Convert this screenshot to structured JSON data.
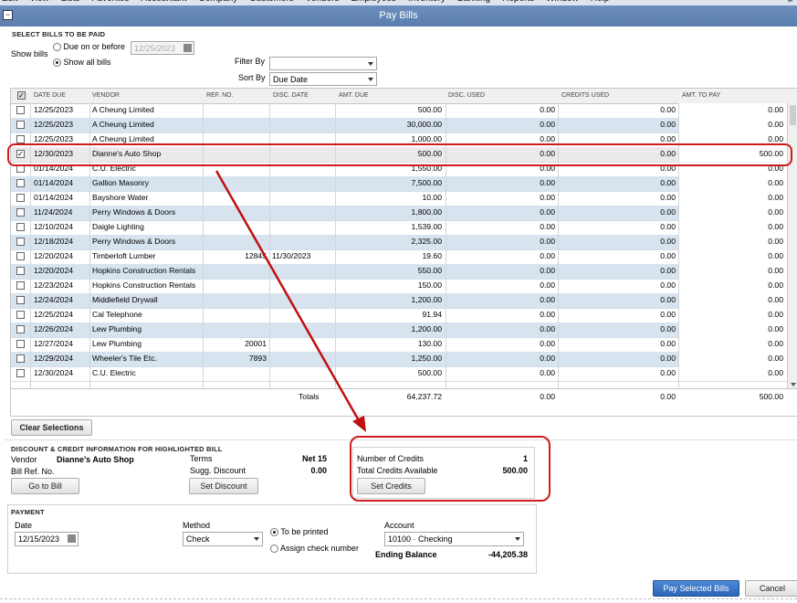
{
  "menubar": [
    "Edit",
    "View",
    "Lists",
    "Favorites",
    "Accountant",
    "Company",
    "Customers",
    "Vendors",
    "Employees",
    "Inventory",
    "Banking",
    "Reports",
    "Window",
    "Help"
  ],
  "window": {
    "title": "Pay Bills"
  },
  "select_section": {
    "label": "SELECT BILLS TO BE PAID",
    "show_bills_label": "Show bills",
    "due_on_before_label": "Due on or before",
    "due_date_value": "12/25/2023",
    "show_all_label": "Show all bills",
    "filter_by_label": "Filter By",
    "filter_by_value": "",
    "sort_by_label": "Sort By",
    "sort_by_value": "Due Date"
  },
  "table": {
    "columns": [
      "DATE DUE",
      "VENDOR",
      "REF. NO.",
      "DISC. DATE",
      "AMT. DUE",
      "DISC. USED",
      "CREDITS USED",
      "AMT. TO PAY"
    ],
    "rows": [
      {
        "checked": false,
        "date": "12/25/2023",
        "vendor": "A Cheung Limited",
        "ref": "",
        "disc_date": "",
        "amt_due": "500.00",
        "disc_used": "0.00",
        "credits_used": "0.00",
        "amt_to_pay": "0.00"
      },
      {
        "checked": false,
        "date": "12/25/2023",
        "vendor": "A Cheung Limited",
        "ref": "",
        "disc_date": "",
        "amt_due": "30,000.00",
        "disc_used": "0.00",
        "credits_used": "0.00",
        "amt_to_pay": "0.00"
      },
      {
        "checked": false,
        "date": "12/25/2023",
        "vendor": "A Cheung Limited",
        "ref": "",
        "disc_date": "",
        "amt_due": "1,000.00",
        "disc_used": "0.00",
        "credits_used": "0.00",
        "amt_to_pay": "0.00"
      },
      {
        "checked": true,
        "date": "12/30/2023",
        "vendor": "Dianne's Auto Shop",
        "ref": "",
        "disc_date": "",
        "amt_due": "500.00",
        "disc_used": "0.00",
        "credits_used": "0.00",
        "amt_to_pay": "500.00"
      },
      {
        "checked": false,
        "date": "01/14/2024",
        "vendor": "C.U. Electric",
        "ref": "",
        "disc_date": "",
        "amt_due": "1,550.00",
        "disc_used": "0.00",
        "credits_used": "0.00",
        "amt_to_pay": "0.00"
      },
      {
        "checked": false,
        "date": "01/14/2024",
        "vendor": "Gallion Masonry",
        "ref": "",
        "disc_date": "",
        "amt_due": "7,500.00",
        "disc_used": "0.00",
        "credits_used": "0.00",
        "amt_to_pay": "0.00"
      },
      {
        "checked": false,
        "date": "01/14/2024",
        "vendor": "Bayshore Water",
        "ref": "",
        "disc_date": "",
        "amt_due": "10.00",
        "disc_used": "0.00",
        "credits_used": "0.00",
        "amt_to_pay": "0.00"
      },
      {
        "checked": false,
        "date": "11/24/2024",
        "vendor": "Perry Windows & Doors",
        "ref": "",
        "disc_date": "",
        "amt_due": "1,800.00",
        "disc_used": "0.00",
        "credits_used": "0.00",
        "amt_to_pay": "0.00"
      },
      {
        "checked": false,
        "date": "12/10/2024",
        "vendor": "Daigle Lighting",
        "ref": "",
        "disc_date": "",
        "amt_due": "1,539.00",
        "disc_used": "0.00",
        "credits_used": "0.00",
        "amt_to_pay": "0.00"
      },
      {
        "checked": false,
        "date": "12/18/2024",
        "vendor": "Perry Windows & Doors",
        "ref": "",
        "disc_date": "",
        "amt_due": "2,325.00",
        "disc_used": "0.00",
        "credits_used": "0.00",
        "amt_to_pay": "0.00"
      },
      {
        "checked": false,
        "date": "12/20/2024",
        "vendor": "Timberloft Lumber",
        "ref": "12845",
        "disc_date": "11/30/2023",
        "amt_due": "19.60",
        "disc_used": "0.00",
        "credits_used": "0.00",
        "amt_to_pay": "0.00"
      },
      {
        "checked": false,
        "date": "12/20/2024",
        "vendor": "Hopkins Construction Rentals",
        "ref": "",
        "disc_date": "",
        "amt_due": "550.00",
        "disc_used": "0.00",
        "credits_used": "0.00",
        "amt_to_pay": "0.00"
      },
      {
        "checked": false,
        "date": "12/23/2024",
        "vendor": "Hopkins Construction Rentals",
        "ref": "",
        "disc_date": "",
        "amt_due": "150.00",
        "disc_used": "0.00",
        "credits_used": "0.00",
        "amt_to_pay": "0.00"
      },
      {
        "checked": false,
        "date": "12/24/2024",
        "vendor": "Middlefield Drywall",
        "ref": "",
        "disc_date": "",
        "amt_due": "1,200.00",
        "disc_used": "0.00",
        "credits_used": "0.00",
        "amt_to_pay": "0.00"
      },
      {
        "checked": false,
        "date": "12/25/2024",
        "vendor": "Cal Telephone",
        "ref": "",
        "disc_date": "",
        "amt_due": "91.94",
        "disc_used": "0.00",
        "credits_used": "0.00",
        "amt_to_pay": "0.00"
      },
      {
        "checked": false,
        "date": "12/26/2024",
        "vendor": "Lew Plumbing",
        "ref": "",
        "disc_date": "",
        "amt_due": "1,200.00",
        "disc_used": "0.00",
        "credits_used": "0.00",
        "amt_to_pay": "0.00"
      },
      {
        "checked": false,
        "date": "12/27/2024",
        "vendor": "Lew Plumbing",
        "ref": "20001",
        "disc_date": "",
        "amt_due": "130.00",
        "disc_used": "0.00",
        "credits_used": "0.00",
        "amt_to_pay": "0.00"
      },
      {
        "checked": false,
        "date": "12/29/2024",
        "vendor": "Wheeler's Tile Etc.",
        "ref": "7893",
        "disc_date": "",
        "amt_due": "1,250.00",
        "disc_used": "0.00",
        "credits_used": "0.00",
        "amt_to_pay": "0.00"
      },
      {
        "checked": false,
        "date": "12/30/2024",
        "vendor": "C.U. Electric",
        "ref": "",
        "disc_date": "",
        "amt_due": "500.00",
        "disc_used": "0.00",
        "credits_used": "0.00",
        "amt_to_pay": "0.00"
      }
    ],
    "totals": {
      "label": "Totals",
      "amt_due": "64,237.72",
      "disc_used": "0.00",
      "credits_used": "0.00",
      "amt_to_pay": "500.00"
    }
  },
  "clear_selections_label": "Clear Selections",
  "discount_section": {
    "label": "DISCOUNT & CREDIT INFORMATION FOR HIGHLIGHTED BILL",
    "vendor_label": "Vendor",
    "vendor_value": "Dianne's Auto Shop",
    "bill_ref_label": "Bill Ref. No.",
    "terms_label": "Terms",
    "terms_value": "Net 15",
    "sugg_discount_label": "Sugg. Discount",
    "sugg_discount_value": "0.00",
    "go_to_bill_label": "Go to Bill",
    "set_discount_label": "Set Discount",
    "num_credits_label": "Number of Credits",
    "num_credits_value": "1",
    "total_credits_label": "Total Credits Available",
    "total_credits_value": "500.00",
    "set_credits_label": "Set Credits"
  },
  "payment": {
    "label": "PAYMENT",
    "date_label": "Date",
    "date_value": "12/15/2023",
    "method_label": "Method",
    "method_value": "Check",
    "to_be_printed_label": "To be printed",
    "assign_check_label": "Assign check number",
    "account_label": "Account",
    "account_value": "10100 · Checking",
    "ending_balance_label": "Ending Balance",
    "ending_balance_value": "-44,205.38"
  },
  "pay_selected_label": "Pay Selected Bills",
  "cancel_label": "Cancel",
  "colors": {
    "annotation_red": "#d11a1a",
    "title_blue": "#6d8fbd",
    "row_alt": "#d7e3ef"
  }
}
